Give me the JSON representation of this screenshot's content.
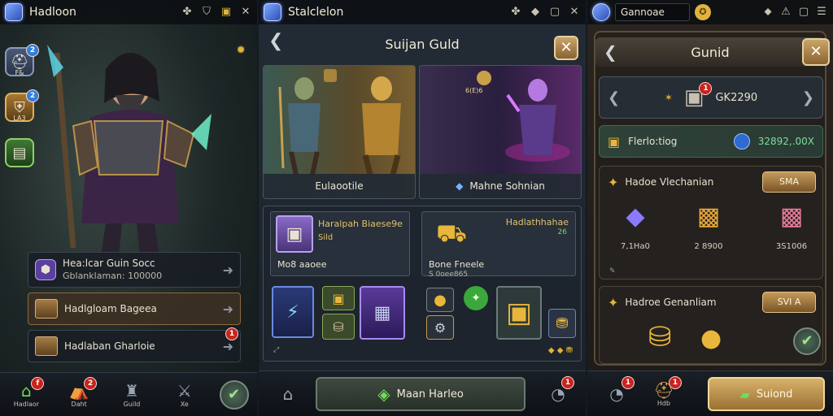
{
  "panel1": {
    "title": "Hadloon",
    "side_badges": [
      "2",
      "2"
    ],
    "side_labels": [
      "F&",
      "LA3"
    ],
    "rows": [
      {
        "title": "Hea:lcar Guin Socc",
        "sub": "Gblanklaman: 100000"
      },
      {
        "title": "Hadlgloam Bageea",
        "sub": ""
      },
      {
        "title": "Hadlaban Gharloie",
        "sub": "",
        "badge": "1"
      }
    ],
    "nav": [
      {
        "label": "Hadlaor",
        "badge": "f"
      },
      {
        "label": "Daht",
        "badge": "2"
      },
      {
        "label": "Guild",
        "badge": ""
      },
      {
        "label": "Xe",
        "badge": ""
      }
    ]
  },
  "panel2": {
    "topbar_title": "Stalclelon",
    "title": "Suijan Guld",
    "cards": [
      {
        "caption": "Eulaootile"
      },
      {
        "caption": "Mahne Sohnian"
      }
    ],
    "card_small_label": "6(E)6",
    "left_box": {
      "title": "Haralpah Biaese9e",
      "sub": "Sild",
      "item_label": "Mo8 aaoee"
    },
    "right_box": {
      "title": "Hadlathhahae",
      "sub": "Bone Fneele",
      "item_label": "S 0oee865",
      "tiny": "26"
    },
    "main_button": "Maan Harleo",
    "nav_badge": "1"
  },
  "panel3": {
    "search_value": "Gannoae",
    "title": "Gunid",
    "coin_label": "GK2290",
    "coin_badge": "1",
    "income": {
      "label": "Flerlo:tiog",
      "value": "32892,.00X"
    },
    "section1": {
      "title": "Hadoe Vlechanian",
      "button": "SMA",
      "rewards": [
        "7,1Ha0",
        "2 8900",
        "3S1006"
      ]
    },
    "section2": {
      "title": "Hadroe Genanliam",
      "button": "SVI A"
    },
    "nav_badges": [
      "1",
      "1"
    ],
    "nav_label": "Hdb",
    "submit": "Suiond"
  },
  "colors": {
    "accent_gold": "#e0b33c",
    "panel_dark": "#1a2129",
    "green": "#6fdc58",
    "red_badge": "#c8241f"
  }
}
